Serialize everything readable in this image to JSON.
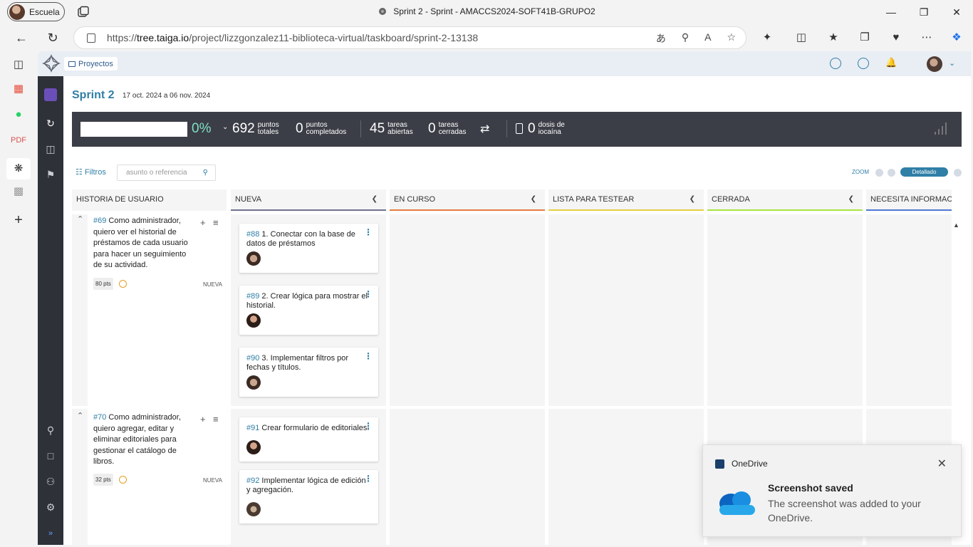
{
  "browser": {
    "profile": "Escuela",
    "window_title": "Sprint 2 - Sprint - AMACCS2024-SOFT41B-GRUPO2",
    "url_prefix": "https://",
    "url_domain": "tree.taiga.io",
    "url_path": "/project/lizzgonzalez11-biblioteca-virtual/taskboard/sprint-2-13138"
  },
  "nav": {
    "projects": "Proyectos"
  },
  "sprint": {
    "title": "Sprint 2",
    "dates": "17 oct. 2024 a 06 nov. 2024"
  },
  "stats": {
    "progress": "0%",
    "progress_fraction": 0,
    "total_points": "692",
    "total_points_label1": "puntos",
    "total_points_label2": "totales",
    "completed_points": "0",
    "completed_label1": "puntos",
    "completed_label2": "completados",
    "open_tasks": "45",
    "open_label1": "tareas",
    "open_label2": "abiertas",
    "closed_tasks": "0",
    "closed_label1": "tareas",
    "closed_label2": "cerradas",
    "iocaine": "0",
    "iocaine_label1": "dosis de",
    "iocaine_label2": "iocaína"
  },
  "toolbar": {
    "filters": "Filtros",
    "search_placeholder": "asunto o referencia",
    "zoom": "ZOOM",
    "zoom_selected": "Detallado"
  },
  "columns": {
    "us": "HISTORIA DE USUARIO",
    "new": "NUEVA",
    "in_progress": "EN CURSO",
    "ready_test": "LISTA PARA TESTEAR",
    "closed": "CERRADA",
    "needs_info": "NECESITA INFORMACIÓN"
  },
  "column_colors": {
    "new": "#70728f",
    "in_progress": "#e47c40",
    "ready_test": "#e4ce40",
    "closed": "#a8e440",
    "needs_info": "#5178d3"
  },
  "stories": [
    {
      "ref": "#69",
      "text1": "Como administrador,",
      "text2": "quiero ver el historial de",
      "text3": "préstamos de cada usuario",
      "text4": "para hacer un seguimiento",
      "text5": "de su actividad.",
      "points": "80 pts",
      "status": "NUEVA",
      "tasks": [
        {
          "ref": "#88",
          "text": "1. Conectar con la base de datos de préstamos"
        },
        {
          "ref": "#89",
          "text": "2. Crear lógica para mostrar el historial."
        },
        {
          "ref": "#90",
          "text": "3. Implementar filtros por fechas y títulos."
        }
      ]
    },
    {
      "ref": "#70",
      "text1": "Como administrador,",
      "text2": "quiero agregar, editar y",
      "text3": "eliminar editoriales para",
      "text4": "gestionar el catálogo de",
      "text5": "libros.",
      "points": "32 pts",
      "status": "NUEVA",
      "tasks": [
        {
          "ref": "#91",
          "text": "Crear formulario de editoriales."
        },
        {
          "ref": "#92",
          "text": "Implementar lógica de edición y agregación."
        }
      ]
    }
  ],
  "toast": {
    "app": "OneDrive",
    "title": "Screenshot saved",
    "body": "The screenshot was added to your OneDrive."
  }
}
